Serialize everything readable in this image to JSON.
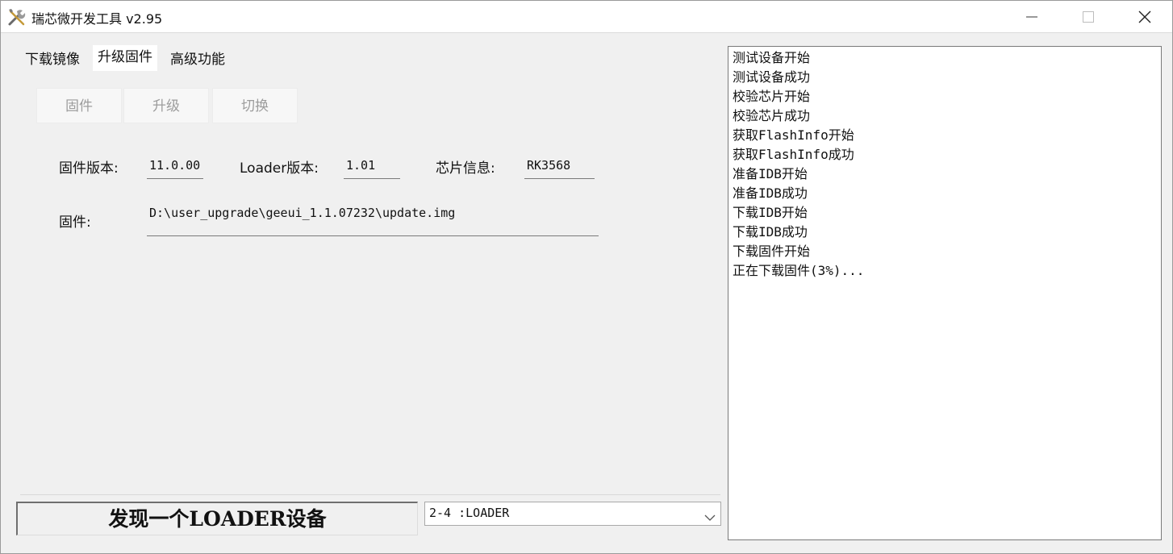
{
  "window": {
    "title": "瑞芯微开发工具 v2.95"
  },
  "tabs": [
    {
      "label": "下载镜像",
      "active": false
    },
    {
      "label": "升级固件",
      "active": true
    },
    {
      "label": "高级功能",
      "active": false
    }
  ],
  "toolbar": {
    "firmware_label": "固件",
    "upgrade_label": "升级",
    "switch_label": "切换"
  },
  "info": {
    "firmware_version_label": "固件版本:",
    "firmware_version": "11.0.00",
    "loader_version_label": "Loader版本:",
    "loader_version": "1.01",
    "chip_info_label": "芯片信息:",
    "chip_info": "RK3568",
    "firmware_path_label": "固件:",
    "firmware_path": "D:\\user_upgrade\\geeui_1.1.07232\\update.img"
  },
  "log": [
    "测试设备开始",
    "测试设备成功",
    "校验芯片开始",
    "校验芯片成功",
    "获取FlashInfo开始",
    "获取FlashInfo成功",
    "准备IDB开始",
    "准备IDB成功",
    "下载IDB开始",
    "下载IDB成功",
    "下载固件开始",
    "正在下载固件(3%)..."
  ],
  "status": {
    "text": "发现一个LOADER设备"
  },
  "device_select": {
    "value": "2-4 :LOADER"
  }
}
